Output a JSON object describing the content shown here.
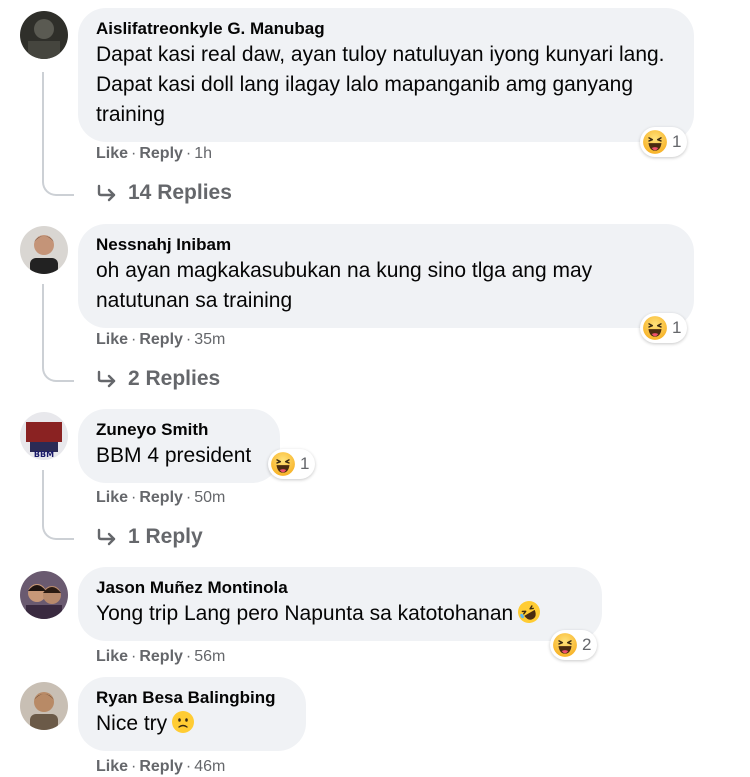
{
  "comments": [
    {
      "author": "Aislifatreonkyle G. Manubag",
      "text": "Dapat kasi real daw, ayan tuloy natuluyan iyong kunyari lang. Dapat kasi doll lang ilagay lalo mapanganib amg ganyang training",
      "like": "Like",
      "reply": "Reply",
      "time": "1h",
      "reaction_count": "1",
      "reaction_icon": "haha-emoji-icon",
      "replies_label": "14 Replies"
    },
    {
      "author": "Nessnahj Inibam",
      "text": "oh ayan magkakasubukan na kung sino tlga ang may natutunan sa training",
      "like": "Like",
      "reply": "Reply",
      "time": "35m",
      "reaction_count": "1",
      "reaction_icon": "haha-emoji-icon",
      "replies_label": "2 Replies"
    },
    {
      "author": "Zuneyo Smith",
      "text": "BBM 4 president",
      "like": "Like",
      "reply": "Reply",
      "time": "50m",
      "reaction_count": "1",
      "reaction_icon": "haha-emoji-icon",
      "replies_label": "1 Reply"
    },
    {
      "author": "Jason Muñez Montinola",
      "text": "Yong trip Lang pero Napunta sa katotohanan",
      "text_emoji": "rolling-laughing-emoji-icon",
      "like": "Like",
      "reply": "Reply",
      "time": "56m",
      "reaction_count": "2",
      "reaction_icon": "haha-emoji-icon"
    },
    {
      "author": "Ryan Besa Balingbing",
      "text": "Nice try",
      "text_emoji": "slightly-frowning-emoji-icon",
      "like": "Like",
      "reply": "Reply",
      "time": "46m"
    }
  ],
  "colors": {
    "bubble": "#f0f2f5",
    "secondary_text": "#65676b",
    "thread_line": "#ccd0d5"
  }
}
